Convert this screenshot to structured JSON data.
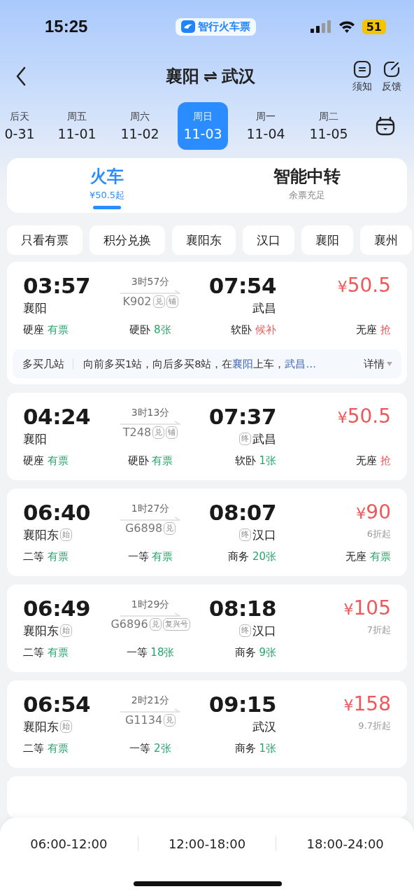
{
  "status_bar": {
    "time": "15:25",
    "app_badge": "智行火车票",
    "battery": "51"
  },
  "header": {
    "title_from": "襄阳",
    "swap": "⇌",
    "title_to": "武汉",
    "actions": [
      {
        "label": "须知",
        "kind": "notice"
      },
      {
        "label": "反馈",
        "kind": "feedback"
      }
    ]
  },
  "dates": [
    {
      "day": "后天",
      "date": "0-31",
      "selected": false
    },
    {
      "day": "周五",
      "date": "11-01",
      "selected": false
    },
    {
      "day": "周六",
      "date": "11-02",
      "selected": false
    },
    {
      "day": "周日",
      "date": "11-03",
      "selected": true
    },
    {
      "day": "周一",
      "date": "11-04",
      "selected": false
    },
    {
      "day": "周二",
      "date": "11-05",
      "selected": false
    }
  ],
  "mode_tabs": [
    {
      "label": "火车",
      "sub": "¥50.5起",
      "selected": true
    },
    {
      "label": "智能中转",
      "sub": "余票充足",
      "selected": false
    }
  ],
  "filters": [
    "只看有票",
    "积分兑换",
    "襄阳东",
    "汉口",
    "襄阳",
    "襄州"
  ],
  "trains": [
    {
      "depart": "03:57",
      "from": "襄阳",
      "duration": "3时57分",
      "number": "K902",
      "tags": [
        "兑",
        "铺"
      ],
      "arrive": "07:54",
      "to": "武昌",
      "price": "50.5",
      "currency": "¥",
      "seats": [
        {
          "name": "硬座",
          "avail": "有票",
          "color": "#27a46a"
        },
        {
          "name": "硬卧",
          "avail": "8张",
          "color": "#27a46a"
        },
        {
          "name": "软卧",
          "avail": "候补",
          "color": "#f0575a"
        },
        {
          "name": "无座",
          "avail": "抢",
          "color": "#f0575a"
        }
      ],
      "extra": {
        "label": "多买几站",
        "segments": [
          {
            "text": "向前多买1站，向后多买8站，在",
            "link": false
          },
          {
            "text": "襄阳",
            "link": true
          },
          {
            "text": "上车，",
            "link": false
          },
          {
            "text": "武昌…",
            "link": true
          }
        ],
        "detail": "详情"
      }
    },
    {
      "depart": "04:24",
      "from": "襄阳",
      "duration": "3时13分",
      "number": "T248",
      "tags": [
        "兑",
        "铺"
      ],
      "arrive": "07:37",
      "to": "武昌",
      "to_badge": "终",
      "price": "50.5",
      "currency": "¥",
      "seats": [
        {
          "name": "硬座",
          "avail": "有票",
          "color": "#27a46a"
        },
        {
          "name": "硬卧",
          "avail": "有票",
          "color": "#27a46a"
        },
        {
          "name": "软卧",
          "avail": "1张",
          "color": "#27a46a"
        },
        {
          "name": "无座",
          "avail": "抢",
          "color": "#f0575a"
        }
      ]
    },
    {
      "depart": "06:40",
      "from": "襄阳东",
      "from_badge": "始",
      "duration": "1时27分",
      "number": "G6898",
      "tags": [
        "兑"
      ],
      "arrive": "08:07",
      "to": "汉口",
      "to_badge": "终",
      "price": "90",
      "currency": "¥",
      "discount": "6折起",
      "seats": [
        {
          "name": "二等",
          "avail": "有票",
          "color": "#27a46a"
        },
        {
          "name": "一等",
          "avail": "有票",
          "color": "#27a46a"
        },
        {
          "name": "商务",
          "avail": "20张",
          "color": "#27a46a"
        },
        {
          "name": "无座",
          "avail": "有票",
          "color": "#27a46a"
        }
      ]
    },
    {
      "depart": "06:49",
      "from": "襄阳东",
      "from_badge": "始",
      "duration": "1时29分",
      "number": "G6896",
      "tags": [
        "兑",
        "复兴号"
      ],
      "arrive": "08:18",
      "to": "汉口",
      "to_badge": "终",
      "price": "105",
      "currency": "¥",
      "discount": "7折起",
      "seats": [
        {
          "name": "二等",
          "avail": "有票",
          "color": "#27a46a"
        },
        {
          "name": "一等",
          "avail": "18张",
          "color": "#27a46a"
        },
        {
          "name": "商务",
          "avail": "9张",
          "color": "#27a46a"
        }
      ]
    },
    {
      "depart": "06:54",
      "from": "襄阳东",
      "from_badge": "始",
      "duration": "2时21分",
      "number": "G1134",
      "tags": [
        "兑"
      ],
      "arrive": "09:15",
      "to": "武汉",
      "price": "158",
      "currency": "¥",
      "discount": "9.7折起",
      "seats": [
        {
          "name": "二等",
          "avail": "有票",
          "color": "#27a46a"
        },
        {
          "name": "一等",
          "avail": "2张",
          "color": "#27a46a"
        },
        {
          "name": "商务",
          "avail": "1张",
          "color": "#27a46a"
        }
      ]
    }
  ],
  "time_ranges": [
    "06:00-12:00",
    "12:00-18:00",
    "18:00-24:00"
  ]
}
